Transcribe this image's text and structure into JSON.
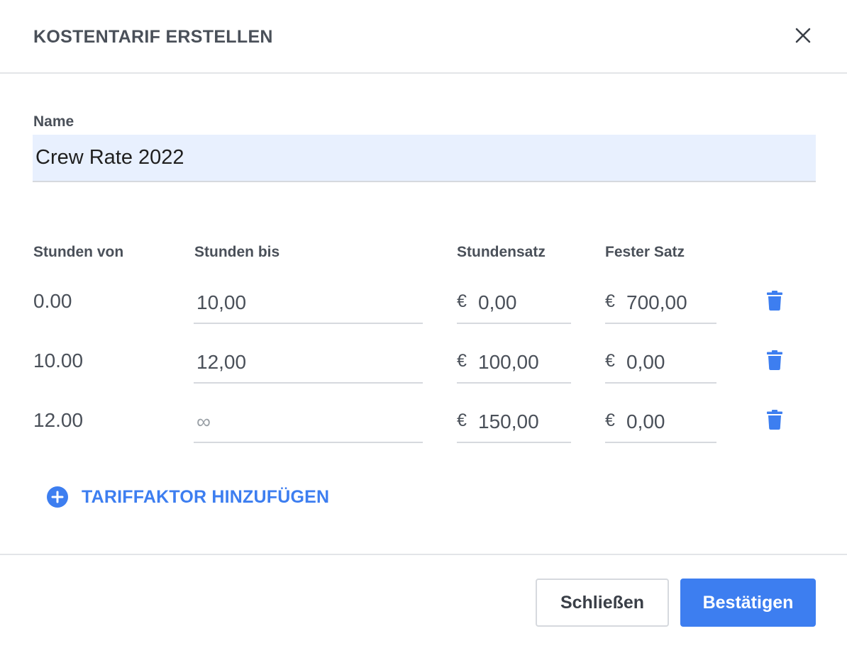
{
  "dialog": {
    "title": "KOSTENTARIF ERSTELLEN",
    "close_icon": "close-icon"
  },
  "name_field": {
    "label": "Name",
    "value": "Crew Rate 2022"
  },
  "table": {
    "headers": {
      "hours_from": "Stunden von",
      "hours_to": "Stunden bis",
      "hourly_rate": "Stundensatz",
      "fixed_rate": "Fester Satz"
    },
    "currency_symbol": "€",
    "rows": [
      {
        "hours_from": "0.00",
        "hours_to": "10,00",
        "hours_to_placeholder": "",
        "hourly_rate": "0,00",
        "fixed_rate": "700,00"
      },
      {
        "hours_from": "10.00",
        "hours_to": "12,00",
        "hours_to_placeholder": "",
        "hourly_rate": "100,00",
        "fixed_rate": "0,00"
      },
      {
        "hours_from": "12.00",
        "hours_to": "",
        "hours_to_placeholder": "∞",
        "hourly_rate": "150,00",
        "fixed_rate": "0,00"
      }
    ],
    "delete_icon": "trash-icon"
  },
  "add_factor": {
    "label": "TARIFFAKTOR HINZUFÜGEN",
    "icon": "plus-circle-icon"
  },
  "footer": {
    "close_label": "Schließen",
    "confirm_label": "Bestätigen"
  },
  "colors": {
    "accent": "#3d7ef0",
    "input_highlight": "#e8f0fe",
    "text": "#4a5059",
    "divider": "#e3e5e8"
  }
}
